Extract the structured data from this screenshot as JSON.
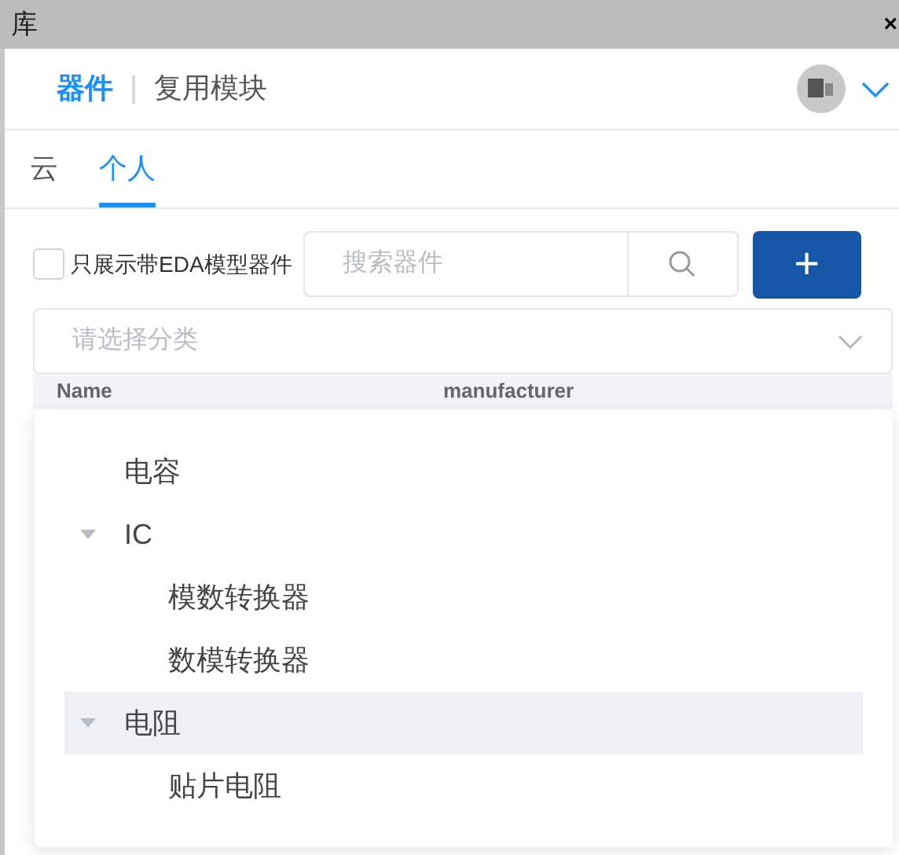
{
  "window": {
    "title": "库",
    "close": "×"
  },
  "header_tabs": [
    {
      "label": "器件",
      "selected": true
    },
    {
      "label": "复用模块",
      "selected": false
    }
  ],
  "scope_tabs": [
    {
      "label": "云",
      "selected": false
    },
    {
      "label": "个人",
      "selected": true
    }
  ],
  "filter": {
    "label": "只展示带EDA模型器件",
    "checked": false
  },
  "search": {
    "placeholder": "搜索器件"
  },
  "add_button": "+",
  "category_select": {
    "placeholder": "请选择分类",
    "expanded": true
  },
  "table": {
    "columns": [
      "Name",
      "manufacturer"
    ]
  },
  "category_tree": [
    {
      "label": "电容",
      "hovered": false
    },
    {
      "label": "IC",
      "hovered": false,
      "expanded": true,
      "children": [
        {
          "label": "模数转换器",
          "hovered": false
        },
        {
          "label": "数模转换器",
          "hovered": false
        }
      ]
    },
    {
      "label": "电阻",
      "hovered": true,
      "expanded": true,
      "children": [
        {
          "label": "贴片电阻",
          "hovered": false
        }
      ]
    }
  ]
}
